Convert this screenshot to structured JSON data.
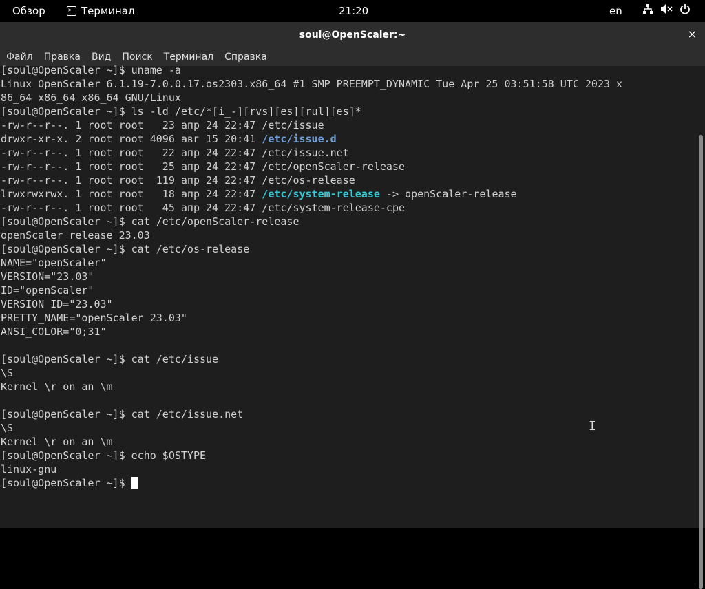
{
  "topbar": {
    "overview": "Обзор",
    "app": "Терминал",
    "clock": "21:20",
    "lang": "en",
    "icons": [
      "network-icon",
      "volume-muted-icon",
      "power-icon"
    ]
  },
  "window": {
    "title": "soul@OpenScaler:~",
    "close": "×"
  },
  "menu": [
    "Файл",
    "Правка",
    "Вид",
    "Поиск",
    "Терминал",
    "Справка"
  ],
  "terminal": {
    "lines": [
      [
        {
          "t": "[soul@OpenScaler ~]$ uname -a"
        }
      ],
      [
        {
          "t": "Linux OpenScaler 6.1.19-7.0.0.17.os2303.x86_64 #1 SMP PREEMPT_DYNAMIC Tue Apr 25 03:51:58 UTC 2023 x"
        }
      ],
      [
        {
          "t": "86_64 x86_64 x86_64 GNU/Linux"
        }
      ],
      [
        {
          "t": "[soul@OpenScaler ~]$ ls -ld /etc/*[i_-][rvs][es][rul][es]*"
        }
      ],
      [
        {
          "t": "-rw-r--r--. 1 root root   23 апр 24 22:47 /etc/issue"
        }
      ],
      [
        {
          "t": "drwxr-xr-x. 2 root root 4096 авг 15 20:41 "
        },
        {
          "t": "/etc/issue.d",
          "c": "dir"
        }
      ],
      [
        {
          "t": "-rw-r--r--. 1 root root   22 апр 24 22:47 /etc/issue.net"
        }
      ],
      [
        {
          "t": "-rw-r--r--. 1 root root   25 апр 24 22:47 /etc/openScaler-release"
        }
      ],
      [
        {
          "t": "-rw-r--r--. 1 root root  119 апр 24 22:47 /etc/os-release"
        }
      ],
      [
        {
          "t": "lrwxrwxrwx. 1 root root   18 апр 24 22:47 "
        },
        {
          "t": "/etc/system-release",
          "c": "link"
        },
        {
          "t": " -> openScaler-release"
        }
      ],
      [
        {
          "t": "-rw-r--r--. 1 root root   45 апр 24 22:47 /etc/system-release-cpe"
        }
      ],
      [
        {
          "t": "[soul@OpenScaler ~]$ cat /etc/openScaler-release"
        }
      ],
      [
        {
          "t": "openScaler release 23.03"
        }
      ],
      [
        {
          "t": "[soul@OpenScaler ~]$ cat /etc/os-release"
        }
      ],
      [
        {
          "t": "NAME=\"openScaler\""
        }
      ],
      [
        {
          "t": "VERSION=\"23.03\""
        }
      ],
      [
        {
          "t": "ID=\"openScaler\""
        }
      ],
      [
        {
          "t": "VERSION_ID=\"23.03\""
        }
      ],
      [
        {
          "t": "PRETTY_NAME=\"openScaler 23.03\""
        }
      ],
      [
        {
          "t": "ANSI_COLOR=\"0;31\""
        }
      ],
      [
        {
          "t": ""
        }
      ],
      [
        {
          "t": "[soul@OpenScaler ~]$ cat /etc/issue"
        }
      ],
      [
        {
          "t": "\\S"
        }
      ],
      [
        {
          "t": "Kernel \\r on an \\m"
        }
      ],
      [
        {
          "t": ""
        }
      ],
      [
        {
          "t": "[soul@OpenScaler ~]$ cat /etc/issue.net"
        }
      ],
      [
        {
          "t": "\\S"
        }
      ],
      [
        {
          "t": "Kernel \\r on an \\m"
        }
      ],
      [
        {
          "t": "[soul@OpenScaler ~]$ echo $OSTYPE"
        }
      ],
      [
        {
          "t": "linux-gnu"
        }
      ],
      [
        {
          "t": "[soul@OpenScaler ~]$ "
        }
      ]
    ]
  }
}
